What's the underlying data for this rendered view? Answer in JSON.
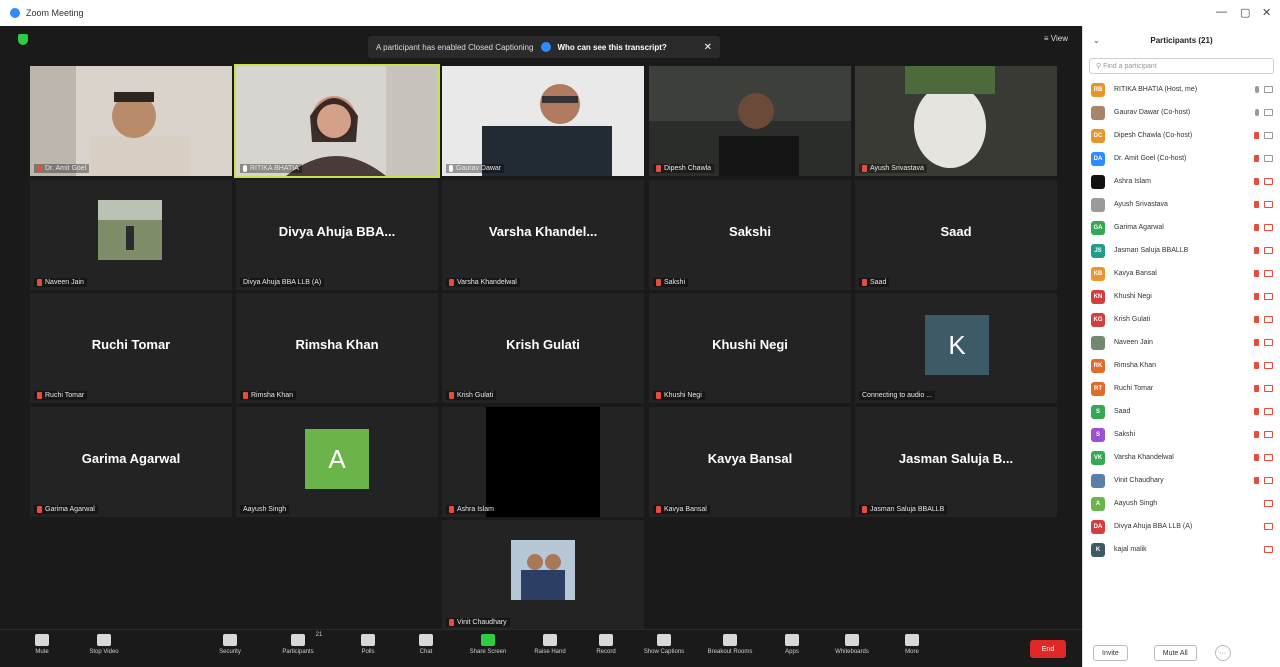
{
  "window": {
    "title": "Zoom Meeting",
    "minimize": "—",
    "maximize": "▢",
    "close": "✕"
  },
  "stage": {
    "view_label": "≡ View",
    "banner": {
      "text": "A participant has enabled Closed Captioning",
      "link": "Who can see this transcript?",
      "close": "✕"
    }
  },
  "tiles": [
    {
      "name": "Dr. Amit Goel",
      "label": "Dr. Amit Goel",
      "muted": true
    },
    {
      "name": "RITIKA BHATIA",
      "label": "RITIKA BHATIA",
      "muted": false
    },
    {
      "name": "Gaurav Dawar",
      "label": "Gaurav Dawar",
      "muted": false
    },
    {
      "name": "Dipesh Chawla",
      "label": "Dipesh Chawla",
      "muted": true
    },
    {
      "name": "Ayush Srivastava",
      "label": "Ayush Srivastava",
      "muted": true
    },
    {
      "name": "Naveen Jain",
      "label": "Naveen Jain",
      "muted": true
    },
    {
      "name": "Divya Ahuja BBA...",
      "label": "Divya Ahuja BBA LLB (A)",
      "muted": false
    },
    {
      "name": "Varsha Khandel...",
      "label": "Varsha Khandelwal",
      "muted": true
    },
    {
      "name": "Sakshi",
      "label": "Sakshi",
      "muted": true
    },
    {
      "name": "Saad",
      "label": "Saad",
      "muted": true
    },
    {
      "name": "Ruchi Tomar",
      "label": "Ruchi Tomar",
      "muted": true
    },
    {
      "name": "Rimsha Khan",
      "label": "Rimsha Khan",
      "muted": true
    },
    {
      "name": "Krish Gulati",
      "label": "Krish Gulati",
      "muted": true
    },
    {
      "name": "Khushi Negi",
      "label": "Khushi Negi",
      "muted": true
    },
    {
      "name": "K",
      "label": "Connecting to audio ...",
      "muted": false
    },
    {
      "name": "Garima Agarwal",
      "label": "Garima Agarwal",
      "muted": true
    },
    {
      "name": "A",
      "label": "Aayush Singh",
      "muted": false
    },
    {
      "name": "Ashra Islam",
      "label": "Ashra Islam",
      "muted": true
    },
    {
      "name": "Kavya Bansal",
      "label": "Kavya Bansal",
      "muted": true
    },
    {
      "name": "Jasman Saluja B...",
      "label": "Jasman Saluja BBALLB",
      "muted": true
    },
    {
      "name": "Vinit Chaudhary",
      "label": "Vinit Chaudhary",
      "muted": true
    }
  ],
  "toolbar": {
    "mute": "Mute",
    "stop_video": "Stop Video",
    "security": "Security",
    "participants": "Participants",
    "participants_count": "21",
    "polls": "Polls",
    "chat": "Chat",
    "share_screen": "Share Screen",
    "raise_hand": "Raise Hand",
    "record": "Record",
    "show_captions": "Show Captions",
    "breakout_rooms": "Breakout Rooms",
    "apps": "Apps",
    "whiteboards": "Whiteboards",
    "more": "More",
    "end": "End"
  },
  "panel": {
    "title": "Participants (21)",
    "search_placeholder": "Find a participant",
    "invite": "Invite",
    "mute_all": "Mute All",
    "more": "···",
    "participants": [
      {
        "initials": "RB",
        "name": "RITIKA BHATIA (Host, me)",
        "color": "#e8952b"
      },
      {
        "initials": "",
        "name": "Gaurav Dawar (Co-host)",
        "color": "#a7856b"
      },
      {
        "initials": "DC",
        "name": "Dipesh Chawla (Co-host)",
        "color": "#e8952b"
      },
      {
        "initials": "DA",
        "name": "Dr. Amit Goel (Co-host)",
        "color": "#2d8cff"
      },
      {
        "initials": "",
        "name": "Ashra Islam",
        "color": "#111111"
      },
      {
        "initials": "",
        "name": "Ayush Srivastava",
        "color": "#9a9a9a"
      },
      {
        "initials": "GA",
        "name": "Garima Agarwal",
        "color": "#35a853"
      },
      {
        "initials": "JS",
        "name": "Jasman Saluja BBALLB",
        "color": "#1f9d8a"
      },
      {
        "initials": "KB",
        "name": "Kavya Bansal",
        "color": "#e8952b"
      },
      {
        "initials": "KN",
        "name": "Khushi Negi",
        "color": "#d23f3f"
      },
      {
        "initials": "KG",
        "name": "Krish Gulati",
        "color": "#d23f3f"
      },
      {
        "initials": "",
        "name": "Naveen Jain",
        "color": "#6f8a6f"
      },
      {
        "initials": "RK",
        "name": "Rimsha Khan",
        "color": "#e06b2b"
      },
      {
        "initials": "RT",
        "name": "Ruchi Tomar",
        "color": "#e06b2b"
      },
      {
        "initials": "S",
        "name": "Saad",
        "color": "#35a853"
      },
      {
        "initials": "S",
        "name": "Sakshi",
        "color": "#9b4fd1"
      },
      {
        "initials": "VK",
        "name": "Varsha Khandelwal",
        "color": "#35a853"
      },
      {
        "initials": "",
        "name": "Vinit Chaudhary",
        "color": "#5b7fa6"
      },
      {
        "initials": "A",
        "name": "Aayush Singh",
        "color": "#6bb44a"
      },
      {
        "initials": "DA",
        "name": "Divya Ahuja BBA LLB (A)",
        "color": "#d23f3f"
      },
      {
        "initials": "K",
        "name": "kajal malik",
        "color": "#3e5a66"
      }
    ]
  }
}
